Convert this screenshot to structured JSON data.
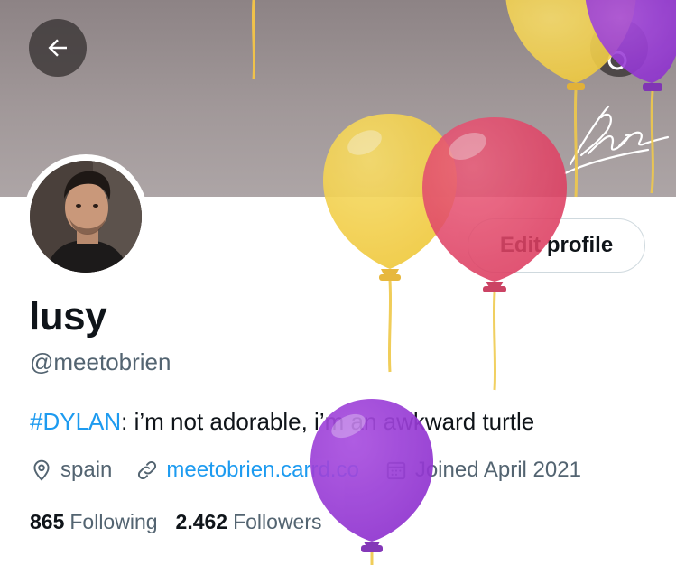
{
  "header": {
    "back_icon": "arrow-left-icon",
    "search_icon": "search-icon"
  },
  "profile": {
    "display_name": "lusy",
    "handle": "@meetobrien",
    "bio_hashtag": "#DYLAN",
    "bio_text": ": i’m not adorable, i’m an awkward turtle",
    "location": "spain",
    "website": "meetobrien.carrd.co",
    "joined": "Joined April 2021",
    "following_count": "865",
    "following_label": "Following",
    "followers_count": "2.462",
    "followers_label": "Followers"
  },
  "actions": {
    "edit_profile_label": "Edit profile"
  },
  "colors": {
    "accent": "#1d9bf0",
    "muted_text": "#536471",
    "balloon_yellow": "#f3cf4c",
    "balloon_red": "#e2446b",
    "balloon_purple": "#9b3fd6"
  }
}
